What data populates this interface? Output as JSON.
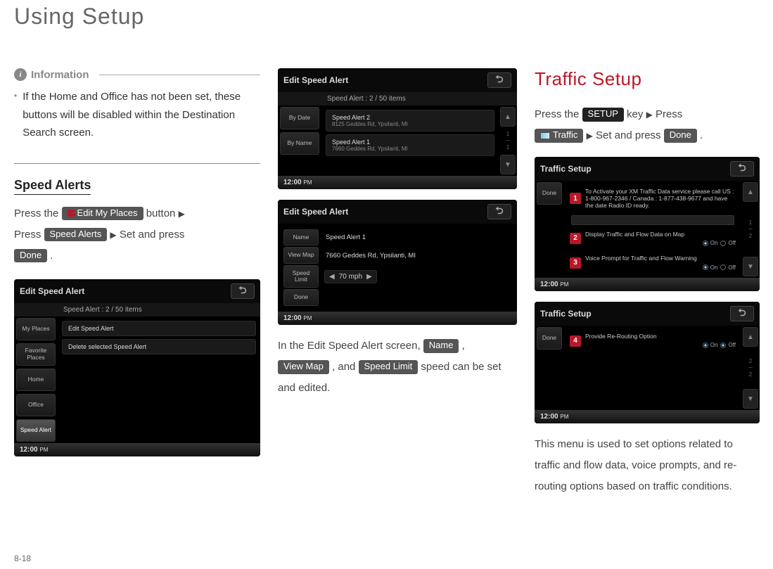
{
  "page_title": "Using Setup",
  "page_number": "8-18",
  "left": {
    "info_label": "Information",
    "info_bullet": "If the Home and Office has not been set, these buttons will be disabled within the Destination Search screen.",
    "subheading": "Speed Alerts",
    "prefix1": "Press the ",
    "btn_edit": "Edit My Places",
    "after_edit": " button ",
    "prefix2": "Press ",
    "btn_speedalerts": "Speed Alerts",
    "after_speedalerts": " Set and press",
    "btn_done": "Done",
    "period": "."
  },
  "mid": {
    "body_prefix": "In the Edit Speed Alert screen, ",
    "btn_name": "Name",
    "comma1": " ,",
    "btn_viewmap": "View Map",
    "comma2": " , and ",
    "btn_speedlimit": "Speed Limit",
    "body_suffix": " speed can be set and edited."
  },
  "right": {
    "title": "Traffic Setup",
    "line_prefix": " Press the ",
    "btn_setup": "SETUP",
    "after_setup": " key ",
    "after_tri": " Press",
    "btn_traffic": "Traffic",
    "after_traffic": " Set and press ",
    "btn_done": "Done",
    "period": ".",
    "paragraph": "This menu is used to set options related to traffic and flow data, voice prompts, and re-routing options based on traffic conditions."
  },
  "arrow": "▶",
  "shots": {
    "s1": {
      "title": "Edit Speed Alert",
      "sub": "Speed Alert : 2 / 50 items",
      "side": [
        "My Places",
        "Favorite Places",
        "Home",
        "Office",
        "Speed Alert"
      ],
      "rows": [
        "Edit Speed Alert",
        "Delete selected Speed Alert"
      ],
      "time": "12:00",
      "ampm": "PM"
    },
    "s2": {
      "title": "Edit Speed Alert",
      "sub": "Speed Alert : 2 / 50 items",
      "side": [
        "By Date",
        "By Name"
      ],
      "r1": "Speed Alert 2",
      "r1s": "8125 Geddes Rd, Ypsilanti, MI",
      "r2": "Speed Alert 1",
      "r2s": "7660 Geddes Rd, Ypsilanti, MI",
      "page": "1",
      "pages": "1",
      "time": "12:00",
      "ampm": "PM"
    },
    "s3": {
      "title": "Edit Speed Alert",
      "name_lbl": "Name",
      "name_val": "Speed Alert 1",
      "vm_lbl": "View Map",
      "vm_val": "7660 Geddes Rd, Ypsilanti, MI",
      "sl_lbl": "Speed Limit",
      "sl_val": "70 mph",
      "done_lbl": "Done",
      "time": "12:00",
      "ampm": "PM"
    },
    "t1": {
      "title": "Traffic Setup",
      "done": "Done",
      "n1": "1",
      "t1": "To Activate your XM Traffic Data service please call US : 1-800-967-2346 / Canada : 1-877-438-9677 and have the date Radio ID ready.",
      "n2": "2",
      "t2": "Display Traffic and Flow Data on Map",
      "n3": "3",
      "t3": "Voice Prompt for Traffic and Flow Warning",
      "on": "On",
      "off": "Off",
      "page": "1",
      "pages": "2",
      "time": "12:00",
      "ampm": "PM"
    },
    "t2": {
      "title": "Traffic Setup",
      "done": "Done",
      "n4": "4",
      "t4": "Provide Re-Routing Option",
      "on": "On",
      "off": "Off",
      "page": "2",
      "pages": "2",
      "time": "12:00",
      "ampm": "PM"
    }
  }
}
